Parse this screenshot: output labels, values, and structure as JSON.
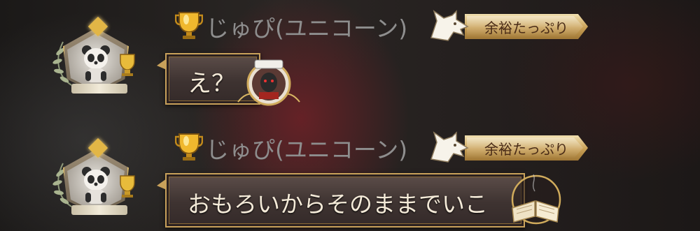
{
  "messages": [
    {
      "username": "じゅぴ(ユニコーン)",
      "status_tag": "余裕たっぷり",
      "text": "え？",
      "avatar_icon": "panda-emblem-icon",
      "rank_icon": "gold-trophy-icon",
      "tag_icon": "wolf-icon",
      "attachment_icon": "hunter-portrait-badge-icon"
    },
    {
      "username": "じゅぴ(ユニコーン)",
      "status_tag": "余裕たっぷり",
      "text": "おもろいからそのままでいこ",
      "avatar_icon": "panda-emblem-icon",
      "rank_icon": "gold-trophy-icon",
      "tag_icon": "wolf-icon",
      "attachment_icon": "open-book-icon"
    }
  ],
  "colors": {
    "name": "#8e8e8e",
    "tag_gold": "#c89f55",
    "bubble_border": "#c8a15a",
    "message_text": "#f4ead8"
  }
}
